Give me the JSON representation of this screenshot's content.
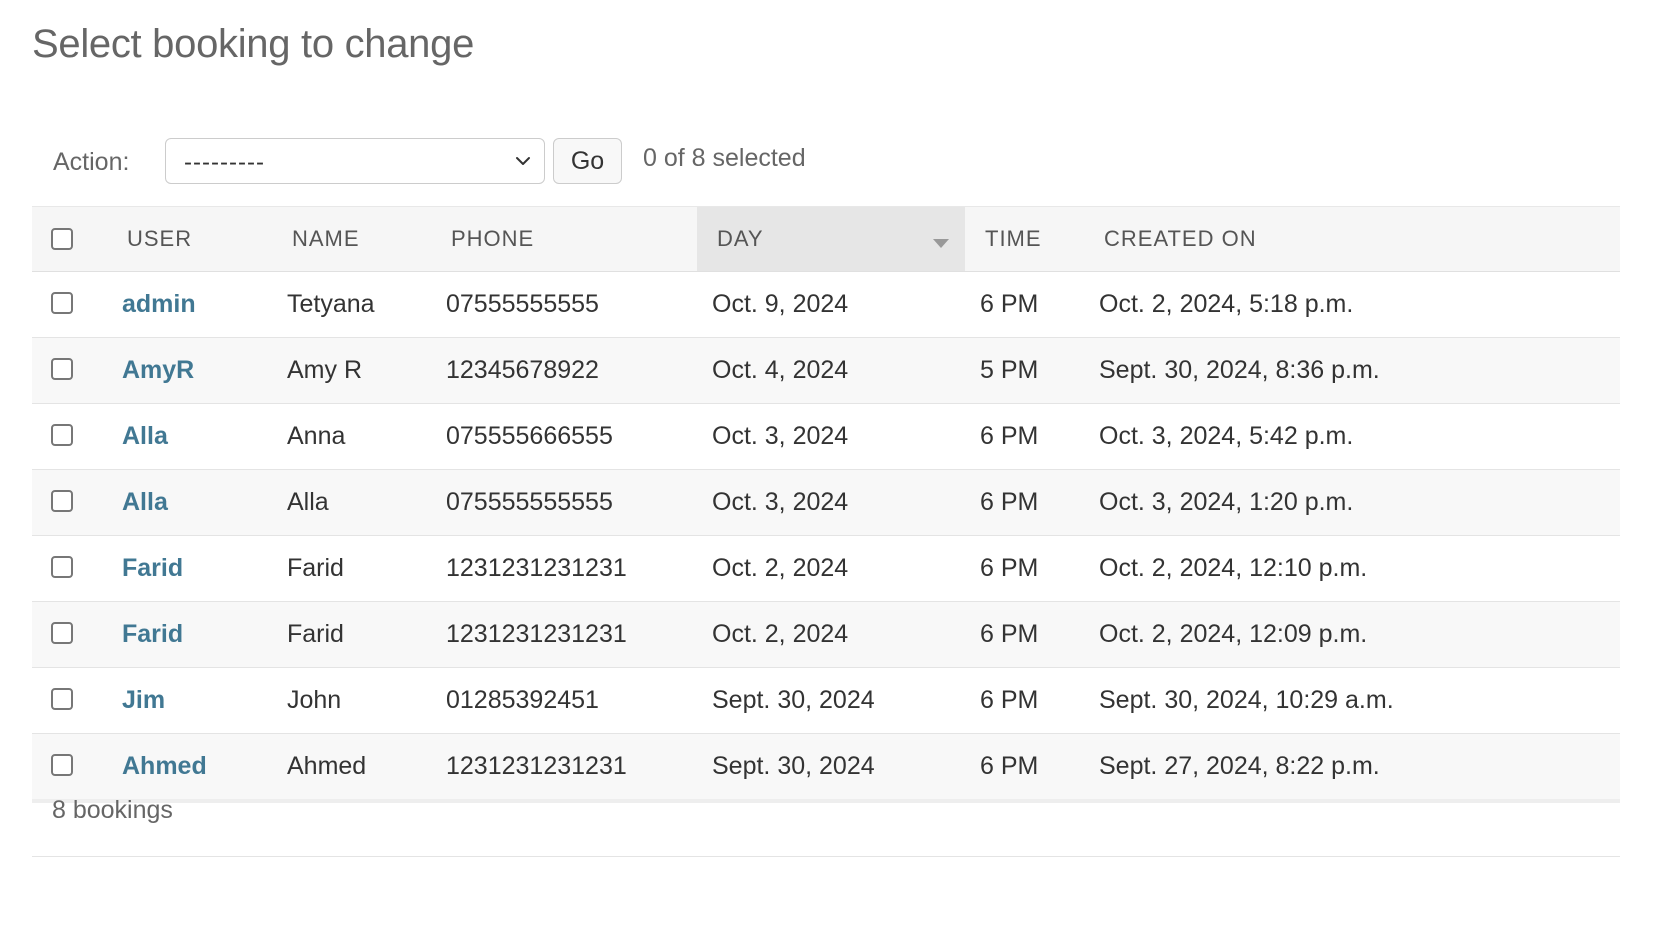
{
  "page": {
    "title": "Select booking to change"
  },
  "actions": {
    "label": "Action:",
    "selected_option": "---------",
    "go_label": "Go",
    "selection_count": "0 of 8 selected"
  },
  "table": {
    "columns": [
      "USER",
      "NAME",
      "PHONE",
      "DAY",
      "TIME",
      "CREATED ON"
    ],
    "sorted_column": "DAY",
    "sort_direction": "descending",
    "rows": [
      {
        "user": "admin",
        "name": "Tetyana",
        "phone": "07555555555",
        "day": "Oct. 9, 2024",
        "time": "6 PM",
        "created_on": "Oct. 2, 2024, 5:18 p.m."
      },
      {
        "user": "AmyR",
        "name": "Amy R",
        "phone": "12345678922",
        "day": "Oct. 4, 2024",
        "time": "5 PM",
        "created_on": "Sept. 30, 2024, 8:36 p.m."
      },
      {
        "user": "Alla",
        "name": "Anna",
        "phone": "075555666555",
        "day": "Oct. 3, 2024",
        "time": "6 PM",
        "created_on": "Oct. 3, 2024, 5:42 p.m."
      },
      {
        "user": "Alla",
        "name": "Alla",
        "phone": "075555555555",
        "day": "Oct. 3, 2024",
        "time": "6 PM",
        "created_on": "Oct. 3, 2024, 1:20 p.m."
      },
      {
        "user": "Farid",
        "name": "Farid",
        "phone": "1231231231231",
        "day": "Oct. 2, 2024",
        "time": "6 PM",
        "created_on": "Oct. 2, 2024, 12:10 p.m."
      },
      {
        "user": "Farid",
        "name": "Farid",
        "phone": "1231231231231",
        "day": "Oct. 2, 2024",
        "time": "6 PM",
        "created_on": "Oct. 2, 2024, 12:09 p.m."
      },
      {
        "user": "Jim",
        "name": "John",
        "phone": "01285392451",
        "day": "Sept. 30, 2024",
        "time": "6 PM",
        "created_on": "Sept. 30, 2024, 10:29 a.m."
      },
      {
        "user": "Ahmed",
        "name": "Ahmed",
        "phone": "1231231231231",
        "day": "Sept. 30, 2024",
        "time": "6 PM",
        "created_on": "Sept. 27, 2024, 8:22 p.m."
      }
    ]
  },
  "footer": {
    "count_text": "8 bookings"
  },
  "colors": {
    "link": "#417893",
    "header_bg": "#f6f6f6",
    "sorted_header_bg": "#e6e6e6",
    "stripe_bg": "#f8f8f8"
  },
  "icons": {
    "select_arrow": "chevron-down-icon",
    "sort_indicator": "sort-descending-icon",
    "row_select": "checkbox"
  }
}
